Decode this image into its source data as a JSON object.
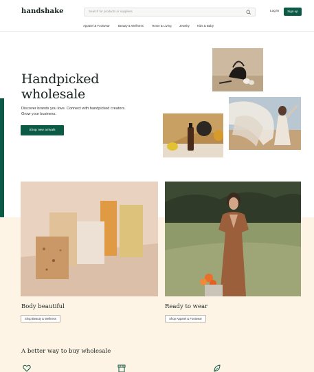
{
  "header": {
    "logo": "handshake",
    "search_placeholder": "Search for products or suppliers",
    "login_label": "Log in",
    "signup_label": "Sign up"
  },
  "nav": {
    "items": [
      "Apparel & Footwear",
      "Beauty & Wellness",
      "Home & Living",
      "Jewelry",
      "Kids & Baby"
    ]
  },
  "hero": {
    "title_line1": "Handpicked",
    "title_line2": "wholesale",
    "subtitle": "Discover brands you love. Connect with handpicked creators. Grow your business.",
    "button_label": "Shop new arrivals"
  },
  "cards": [
    {
      "title": "Body beautiful",
      "button_label": "Shop Beauty & Wellness"
    },
    {
      "title": "Ready to wear",
      "button_label": "Shop Apparel & Footwear"
    }
  ],
  "section": {
    "title": "A better way to buy wholesale"
  },
  "icons": {
    "search": "search-icon",
    "features": [
      "heart-icon",
      "storefront-icon",
      "leaf-icon"
    ]
  },
  "colors": {
    "brand_green": "#0b5a45",
    "cream": "#fdf4e5"
  }
}
